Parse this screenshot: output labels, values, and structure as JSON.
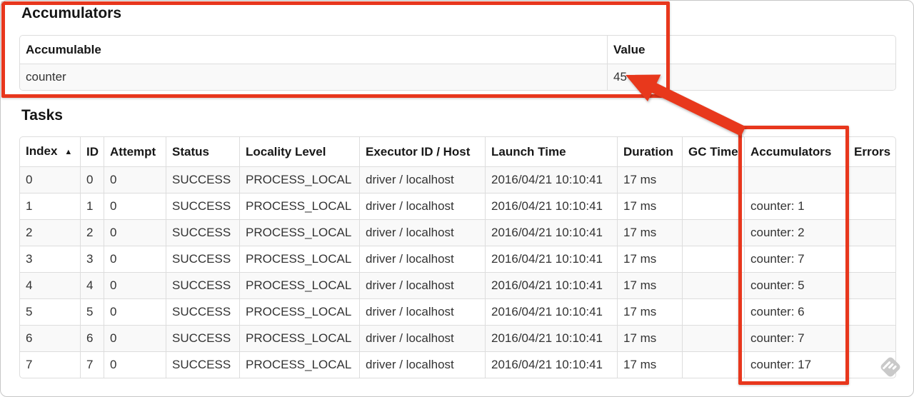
{
  "colors": {
    "annotation_red": "#e8371d",
    "table_border": "#dddddd",
    "row_stripe": "#f9f9f9",
    "watermark_gray": "#c9c9c9"
  },
  "accumulators_section": {
    "title": "Accumulators",
    "table": {
      "headers": [
        "Accumulable",
        "Value"
      ],
      "rows": [
        [
          "counter",
          "45"
        ]
      ]
    }
  },
  "tasks_section": {
    "title": "Tasks",
    "table": {
      "headers": [
        "Index",
        "ID",
        "Attempt",
        "Status",
        "Locality Level",
        "Executor ID / Host",
        "Launch Time",
        "Duration",
        "GC Time",
        "Accumulators",
        "Errors"
      ],
      "sort": {
        "column": 0,
        "indicator": "▲"
      },
      "rows": [
        [
          "0",
          "0",
          "0",
          "SUCCESS",
          "PROCESS_LOCAL",
          "driver / localhost",
          "2016/04/21 10:10:41",
          "17 ms",
          "",
          "",
          ""
        ],
        [
          "1",
          "1",
          "0",
          "SUCCESS",
          "PROCESS_LOCAL",
          "driver / localhost",
          "2016/04/21 10:10:41",
          "17 ms",
          "",
          "counter: 1",
          ""
        ],
        [
          "2",
          "2",
          "0",
          "SUCCESS",
          "PROCESS_LOCAL",
          "driver / localhost",
          "2016/04/21 10:10:41",
          "17 ms",
          "",
          "counter: 2",
          ""
        ],
        [
          "3",
          "3",
          "0",
          "SUCCESS",
          "PROCESS_LOCAL",
          "driver / localhost",
          "2016/04/21 10:10:41",
          "17 ms",
          "",
          "counter: 7",
          ""
        ],
        [
          "4",
          "4",
          "0",
          "SUCCESS",
          "PROCESS_LOCAL",
          "driver / localhost",
          "2016/04/21 10:10:41",
          "17 ms",
          "",
          "counter: 5",
          ""
        ],
        [
          "5",
          "5",
          "0",
          "SUCCESS",
          "PROCESS_LOCAL",
          "driver / localhost",
          "2016/04/21 10:10:41",
          "17 ms",
          "",
          "counter: 6",
          ""
        ],
        [
          "6",
          "6",
          "0",
          "SUCCESS",
          "PROCESS_LOCAL",
          "driver / localhost",
          "2016/04/21 10:10:41",
          "17 ms",
          "",
          "counter: 7",
          ""
        ],
        [
          "7",
          "7",
          "0",
          "SUCCESS",
          "PROCESS_LOCAL",
          "driver / localhost",
          "2016/04/21 10:10:41",
          "17 ms",
          "",
          "counter: 17",
          ""
        ]
      ]
    }
  },
  "annotations": {
    "highlighted_value": "45",
    "highlighted_column": "Accumulators",
    "watermark": "skitch-pencil"
  }
}
